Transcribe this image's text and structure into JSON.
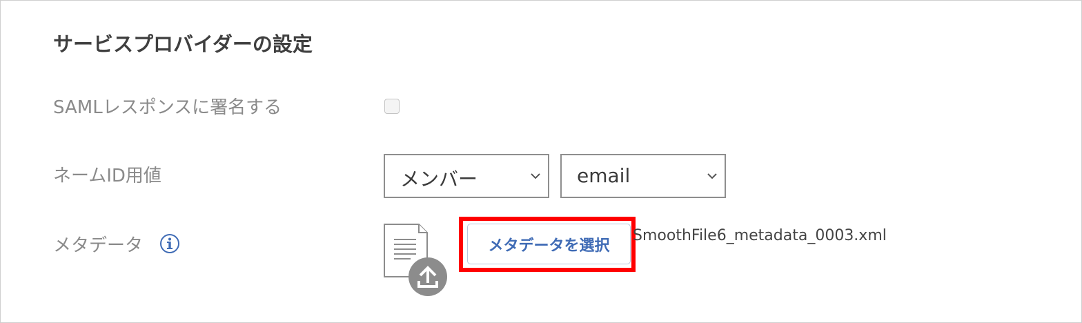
{
  "section": {
    "title": "サービスプロバイダーの設定"
  },
  "saml_response": {
    "label": "SAMLレスポンスに署名する",
    "checked": false
  },
  "name_id": {
    "label": "ネームID用値",
    "source_select": {
      "selected": "メンバー"
    },
    "field_select": {
      "selected": "email"
    }
  },
  "metadata": {
    "label": "メタデータ",
    "select_button_label": "メタデータを選択",
    "file_name": "SmoothFile6_metadata_0003.xml"
  },
  "colors": {
    "accent": "#3f6bb5",
    "highlight": "#ff0000",
    "label_text": "#8a8a8a",
    "icon_gray": "#8c8c8c"
  },
  "icons": {
    "info": "info-circle-icon",
    "file": "document-icon",
    "upload": "upload-icon",
    "dropdown": "chevron-down-icon"
  }
}
